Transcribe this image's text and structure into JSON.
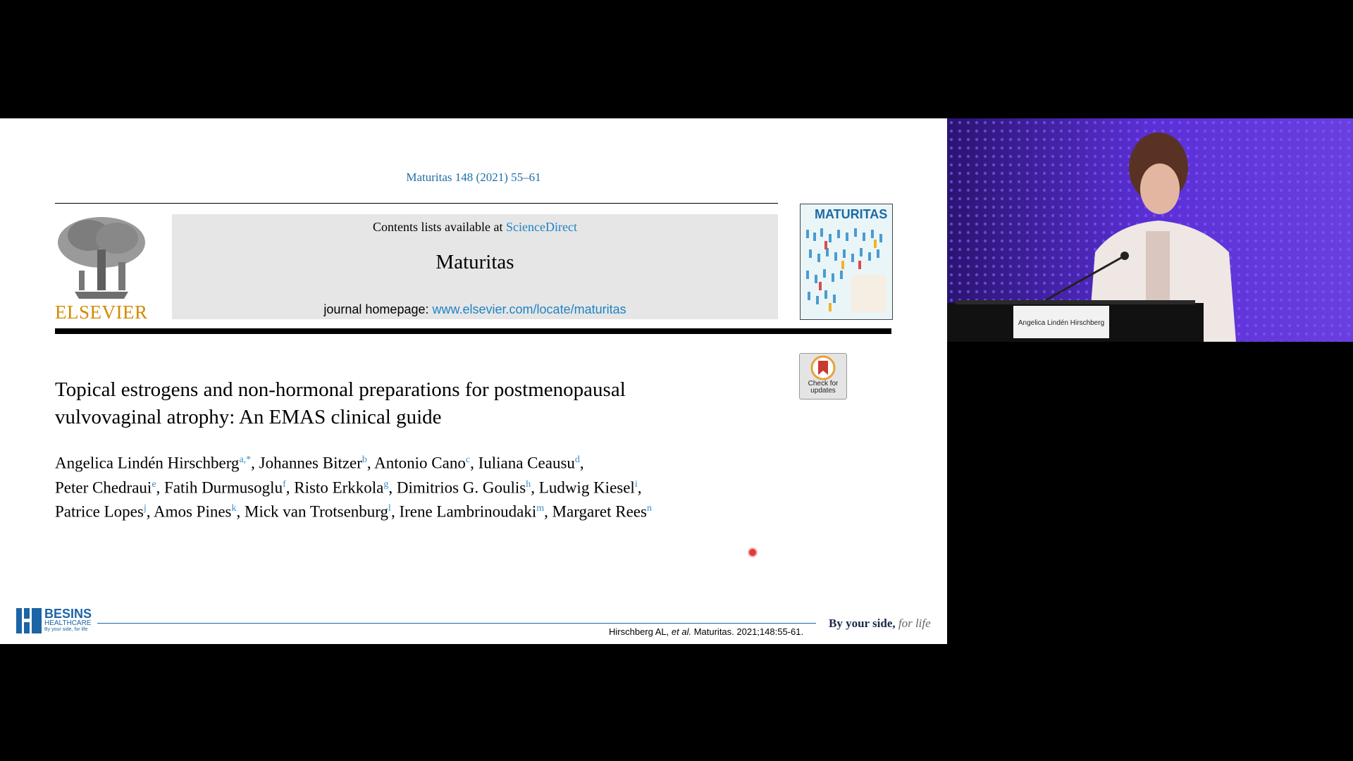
{
  "slide": {
    "journal_reference": "Maturitas 148 (2021) 55–61",
    "publisher_wordmark": "ELSEVIER",
    "contents_prefix": "Contents lists available at",
    "contents_link": "ScienceDirect",
    "journal_name": "Maturitas",
    "homepage_prefix": "journal homepage:",
    "homepage_link": "www.elsevier.com/locate/maturitas",
    "cover_title": "MATURITAS",
    "check_updates": "Check for updates",
    "paper_title_line1": "Topical estrogens and non-hormonal preparations for postmenopausal",
    "paper_title_line2": "vulvovaginal atrophy: An EMAS clinical guide",
    "authors": [
      {
        "name": "Angelica Lindén Hirschberg",
        "aff": "a,*"
      },
      {
        "name": "Johannes Bitzer",
        "aff": "b"
      },
      {
        "name": "Antonio Cano",
        "aff": "c"
      },
      {
        "name": "Iuliana Ceausu",
        "aff": "d"
      },
      {
        "name": "Peter Chedraui",
        "aff": "e"
      },
      {
        "name": "Fatih Durmusoglu",
        "aff": "f"
      },
      {
        "name": "Risto Erkkola",
        "aff": "g"
      },
      {
        "name": "Dimitrios G. Goulis",
        "aff": "h"
      },
      {
        "name": "Ludwig Kiesel",
        "aff": "i"
      },
      {
        "name": "Patrice Lopes",
        "aff": "j"
      },
      {
        "name": "Amos Pines",
        "aff": "k"
      },
      {
        "name": "Mick van Trotsenburg",
        "aff": "l"
      },
      {
        "name": "Irene Lambrinoudaki",
        "aff": "m"
      },
      {
        "name": "Margaret Rees",
        "aff": "n"
      }
    ]
  },
  "footer": {
    "brand": "BESINS",
    "brand_sub": "HEALTHCARE",
    "brand_tag": "By your side, for life",
    "citation_authors": "Hirschberg AL,",
    "citation_etal": "et al.",
    "citation_rest": "Maturitas. 2021;148:55-61.",
    "tagline_main": "By your side,",
    "tagline_script": "for life"
  },
  "speaker": {
    "nameplate": "Angelica Lindén Hirschberg"
  },
  "colors": {
    "link_blue": "#1f83c4",
    "elsevier_orange": "#d38a00",
    "besins_blue": "#1b64a6",
    "stage_purple": "#3b1c8c"
  }
}
